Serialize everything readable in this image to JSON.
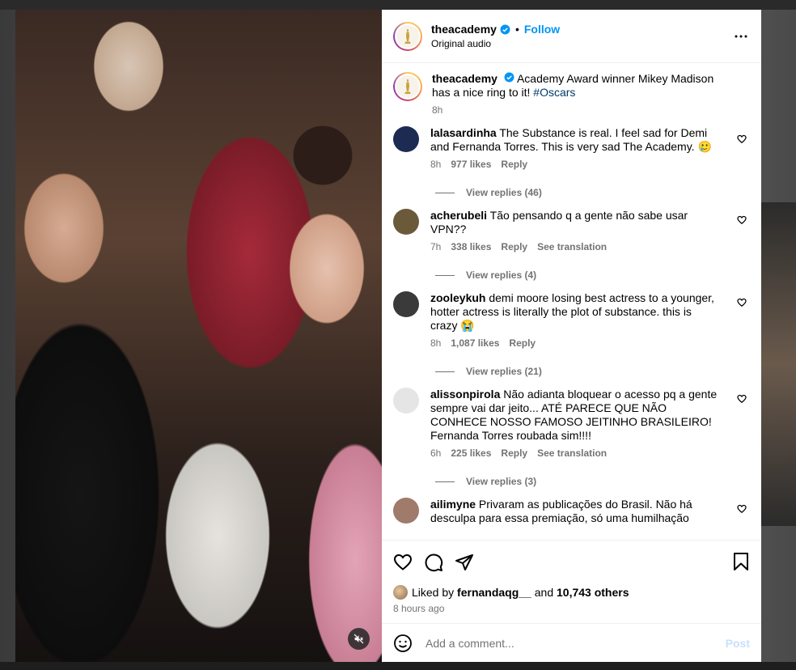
{
  "post": {
    "author": "theacademy",
    "follow_label": "Follow",
    "audio_label": "Original audio",
    "caption_text": "Academy Award winner Mikey Madison has a nice ring to it!",
    "caption_tag": "#Oscars",
    "caption_time": "8h"
  },
  "comments": [
    {
      "user": "lalasardinha",
      "text": "The Substance is real. I feel sad for Demi and Fernanda Torres. This is very sad The Academy. 🥲",
      "time": "8h",
      "likes": "977 likes",
      "reply": "Reply",
      "translate": "",
      "view_replies": "View replies (46)",
      "avatar_color": "#1d2b53"
    },
    {
      "user": "acherubeli",
      "text": "Tão pensando q a gente não sabe usar VPN??",
      "time": "7h",
      "likes": "338 likes",
      "reply": "Reply",
      "translate": "See translation",
      "view_replies": "View replies (4)",
      "avatar_color": "#6b5a3a"
    },
    {
      "user": "zooleykuh",
      "text": "demi moore losing best actress to a younger, hotter actress is literally the plot of substance. this is crazy 😭",
      "time": "8h",
      "likes": "1,087 likes",
      "reply": "Reply",
      "translate": "",
      "view_replies": "View replies (21)",
      "avatar_color": "#3a3a3a"
    },
    {
      "user": "alissonpirola",
      "text": "Não adianta bloquear o acesso pq a gente sempre vai dar jeito... ATÉ PARECE QUE NÃO CONHECE NOSSO FAMOSO JEITINHO BRASILEIRO!\nFernanda Torres roubada sim!!!!",
      "time": "6h",
      "likes": "225 likes",
      "reply": "Reply",
      "translate": "See translation",
      "view_replies": "View replies (3)",
      "avatar_color": "#e5e5e5"
    },
    {
      "user": "ailimyne",
      "text": "Privaram as publicações do Brasil. Não há desculpa para essa premiação, só uma humilhação",
      "time": "",
      "likes": "",
      "reply": "",
      "translate": "",
      "view_replies": "",
      "avatar_color": "#a07a6a"
    }
  ],
  "footer": {
    "liked_by_prefix": "Liked by",
    "liked_by_user": "fernandaqg__",
    "liked_by_and": "and",
    "liked_by_count": "10,743 others",
    "time_ago": "8 hours ago",
    "comment_placeholder": "Add a comment...",
    "post_label": "Post"
  },
  "colors": {
    "accent": "#0095f6",
    "secondary_text": "#737373",
    "post_disabled": "#c7e0fd",
    "verified": "#0095f6"
  }
}
